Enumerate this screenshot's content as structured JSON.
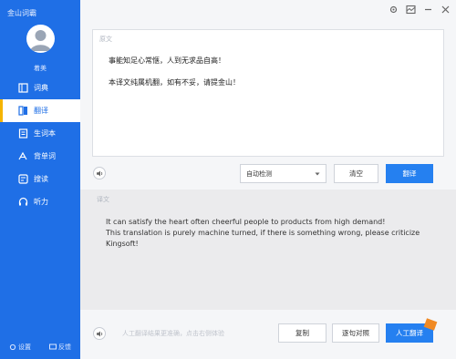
{
  "app": {
    "title": "金山词霸",
    "username": "着美"
  },
  "sidebar": {
    "items": [
      {
        "label": "词典",
        "icon": "book-icon",
        "active": false
      },
      {
        "label": "翻译",
        "icon": "translate-icon",
        "active": true
      },
      {
        "label": "生词本",
        "icon": "vocabulary-icon",
        "active": false
      },
      {
        "label": "背单词",
        "icon": "flashcard-icon",
        "active": false
      },
      {
        "label": "搜读",
        "icon": "reading-icon",
        "active": false
      },
      {
        "label": "听力",
        "icon": "headphones-icon",
        "active": false
      }
    ],
    "bottom": {
      "left_label": "设置",
      "right_label": "反馈"
    }
  },
  "source": {
    "label": "原文",
    "line1": "事能知足心常惬，人到无求品自高！",
    "line2": "本译文纯属机翻，如有不妥，请提金山！"
  },
  "controls": {
    "language": "自动检测",
    "clear_label": "清空",
    "translate_label": "翻译"
  },
  "result": {
    "label": "译文",
    "text_line1": "It can satisfy the heart often cheerful people to products from high demand!",
    "text_line2": "This translation is purely machine turned, if there is something wrong, please criticize Kingsoft!"
  },
  "footer": {
    "tip": "人工翻译结果更准确，点击右侧体验",
    "copy_label": "复制",
    "compare_label": "逐句对照",
    "human_label": "人工翻译"
  },
  "colors": {
    "brand": "#1f6fe6",
    "primary_button": "#2580f0",
    "active_marker": "#f5b400"
  }
}
